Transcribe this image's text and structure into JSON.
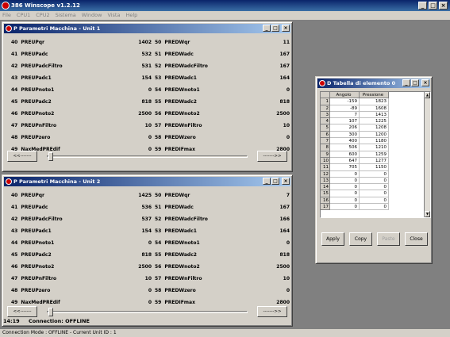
{
  "app": {
    "title": "386 Winscope v1.2.12",
    "buttons": [
      "_",
      "□",
      "×"
    ]
  },
  "menu": [
    "File",
    "CPU1",
    "CPU2",
    "Sistema",
    "Window",
    "Vista",
    "Help"
  ],
  "panel1": {
    "title": "P Parametri Macchina - Unit 1",
    "rows": [
      {
        "id": "40",
        "name": "PREUPqr",
        "val": "1402",
        "id2": "50",
        "name2": "PREDWqr",
        "val2": "11"
      },
      {
        "id": "41",
        "name": "PREUPadc",
        "val": "532",
        "id2": "51",
        "name2": "PREDWadc",
        "val2": "167"
      },
      {
        "id": "42",
        "name": "PREUPadcFiltro",
        "val": "531",
        "id2": "52",
        "name2": "PREDWadcFiltro",
        "val2": "167"
      },
      {
        "id": "43",
        "name": "PREUPadc1",
        "val": "154",
        "id2": "53",
        "name2": "PREDWadc1",
        "val2": "164"
      },
      {
        "id": "44",
        "name": "PREUPnoto1",
        "val": "0",
        "id2": "54",
        "name2": "PREDWnoto1",
        "val2": "0"
      },
      {
        "id": "45",
        "name": "PREUPadc2",
        "val": "818",
        "id2": "55",
        "name2": "PREDWadc2",
        "val2": "818"
      },
      {
        "id": "46",
        "name": "PREUPnoto2",
        "val": "2500",
        "id2": "56",
        "name2": "PREDWnoto2",
        "val2": "2500"
      },
      {
        "id": "47",
        "name": "PREUPnFiltro",
        "val": "10",
        "id2": "57",
        "name2": "PREDWnFiltro",
        "val2": "10"
      },
      {
        "id": "48",
        "name": "PREUPzero",
        "val": "0",
        "id2": "58",
        "name2": "PREDWzero",
        "val2": "0"
      },
      {
        "id": "49",
        "name": "NaxMedPREdif",
        "val": "0",
        "id2": "59",
        "name2": "PREDIFmax",
        "val2": "2800"
      }
    ],
    "prev": "<<-------",
    "next": "------->>"
  },
  "panel2": {
    "title": "P Parametri Macchina - Unit 2",
    "rows": [
      {
        "id": "40",
        "name": "PREUPqr",
        "val": "1425",
        "id2": "50",
        "name2": "PREDWqr",
        "val2": "7"
      },
      {
        "id": "41",
        "name": "PREUPadc",
        "val": "536",
        "id2": "51",
        "name2": "PREDWadc",
        "val2": "167"
      },
      {
        "id": "42",
        "name": "PREUPadcFiltro",
        "val": "537",
        "id2": "52",
        "name2": "PREDWadcFiltro",
        "val2": "166"
      },
      {
        "id": "43",
        "name": "PREUPadc1",
        "val": "154",
        "id2": "53",
        "name2": "PREDWadc1",
        "val2": "164"
      },
      {
        "id": "44",
        "name": "PREUPnoto1",
        "val": "0",
        "id2": "54",
        "name2": "PREDWnoto1",
        "val2": "0"
      },
      {
        "id": "45",
        "name": "PREUPadc2",
        "val": "818",
        "id2": "55",
        "name2": "PREDWadc2",
        "val2": "818"
      },
      {
        "id": "46",
        "name": "PREUPnoto2",
        "val": "2500",
        "id2": "56",
        "name2": "PREDWnoto2",
        "val2": "2500"
      },
      {
        "id": "47",
        "name": "PREUPnFiltro",
        "val": "10",
        "id2": "57",
        "name2": "PREDWnFiltro",
        "val2": "10"
      },
      {
        "id": "48",
        "name": "PREUPzero",
        "val": "0",
        "id2": "58",
        "name2": "PREDWzero",
        "val2": "0"
      },
      {
        "id": "49",
        "name": "NaxMedPREdif",
        "val": "0",
        "id2": "59",
        "name2": "PREDIFmax",
        "val2": "2800"
      }
    ],
    "prev": "<<-------",
    "next": "------->>"
  },
  "connection": {
    "time": "14:19",
    "label": "Connection: OFFLINE"
  },
  "dialog": {
    "title": "D Tabella di elemento 0",
    "headers": [
      "Angolo",
      "Pressione"
    ],
    "rows": [
      {
        "n": "1",
        "a": "-159",
        "p": "1823"
      },
      {
        "n": "2",
        "a": "-89",
        "p": "1608"
      },
      {
        "n": "3",
        "a": "7",
        "p": "1413"
      },
      {
        "n": "4",
        "a": "107",
        "p": "1225"
      },
      {
        "n": "5",
        "a": "206",
        "p": "1208"
      },
      {
        "n": "6",
        "a": "300",
        "p": "1200"
      },
      {
        "n": "7",
        "a": "400",
        "p": "1180"
      },
      {
        "n": "8",
        "a": "506",
        "p": "1210"
      },
      {
        "n": "9",
        "a": "600",
        "p": "1259"
      },
      {
        "n": "10",
        "a": "647",
        "p": "1277"
      },
      {
        "n": "11",
        "a": "705",
        "p": "1150"
      },
      {
        "n": "12",
        "a": "0",
        "p": "0"
      },
      {
        "n": "13",
        "a": "0",
        "p": "0"
      },
      {
        "n": "14",
        "a": "0",
        "p": "0"
      },
      {
        "n": "15",
        "a": "0",
        "p": "0"
      },
      {
        "n": "16",
        "a": "0",
        "p": "0"
      },
      {
        "n": "17",
        "a": "0",
        "p": "0"
      }
    ],
    "buttons": {
      "apply": "Apply",
      "copy": "Copy",
      "paste": "Paste",
      "close": "Close"
    }
  },
  "status": "Connection Mode : OFFLINE - Current Unit ID : 1"
}
